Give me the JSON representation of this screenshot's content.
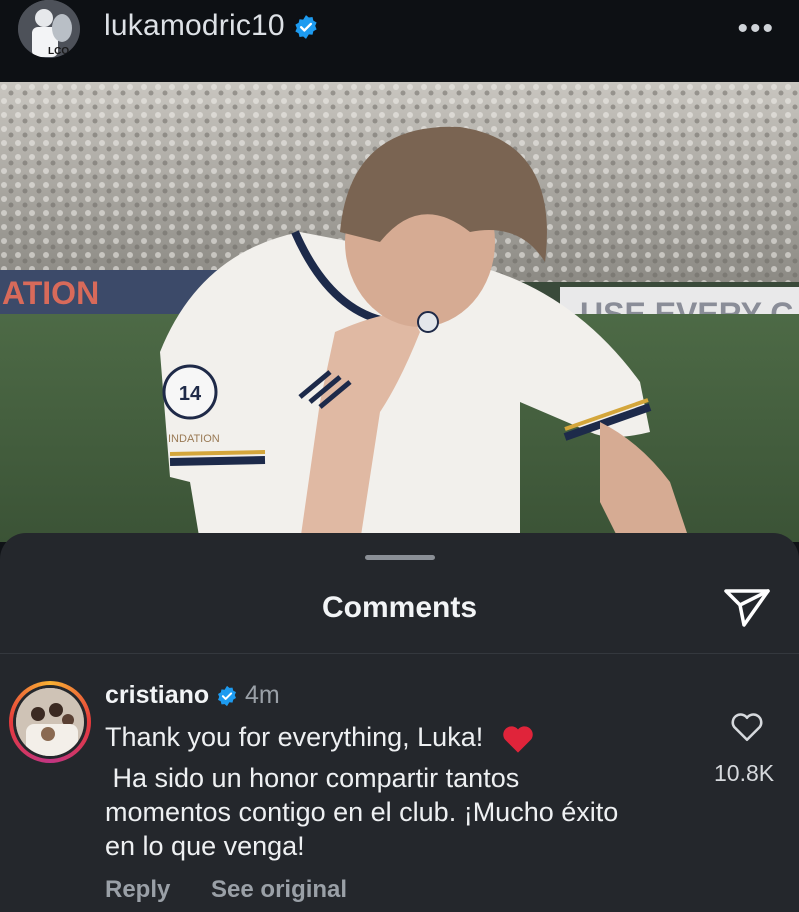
{
  "post": {
    "username": "lukamodric10",
    "verified": true,
    "more_icon": "more-icon"
  },
  "photo": {
    "banner_left": "ATION",
    "banner_right": "USE EVERY C",
    "shirt_text": "INDATION",
    "badge_text": "14"
  },
  "comments_sheet": {
    "title": "Comments",
    "send_icon": "paper-plane-icon",
    "comment": {
      "username": "cristiano",
      "verified": true,
      "time": "4m",
      "line1": "Thank you for everything, Luka!",
      "line2": " Ha sido un honor compartir tantos\nmomentos contigo en el club. ¡Mucho éxito\nen lo que venga!",
      "likes": "10.8K",
      "reply_label": "Reply",
      "see_original_label": "See original"
    }
  },
  "colors": {
    "background": "#0f1216",
    "sheet": "#24272c",
    "verified": "#1d9bf0",
    "heart": "#e0245e"
  }
}
